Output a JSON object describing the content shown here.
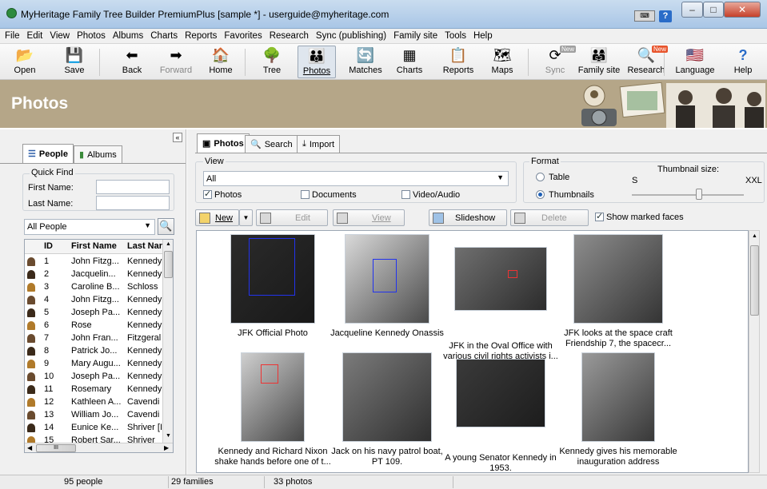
{
  "window": {
    "title": "MyHeritage Family Tree Builder PremiumPlus [sample *] - userguide@myheritage.com",
    "help_label": "?",
    "minimize": "–",
    "maximize": "□",
    "close": "✕"
  },
  "menu": [
    "File",
    "Edit",
    "View",
    "Photos",
    "Albums",
    "Charts",
    "Reports",
    "Favorites",
    "Research",
    "Sync (publishing)",
    "Family site",
    "Tools",
    "Help"
  ],
  "toolbar": [
    {
      "label": "Open",
      "icon": "folder-open-icon",
      "glyph": "📂"
    },
    {
      "label": "Save",
      "icon": "floppy-save-icon",
      "glyph": "💾"
    },
    {
      "label": "Back",
      "icon": "back-arrow-icon",
      "glyph": "⬅"
    },
    {
      "label": "Forward",
      "icon": "forward-arrow-icon",
      "glyph": "➡"
    },
    {
      "label": "Home",
      "icon": "home-icon",
      "glyph": "🏠"
    },
    {
      "label": "Tree",
      "icon": "tree-icon",
      "glyph": "🌳"
    },
    {
      "label": "Photos",
      "icon": "photos-icon",
      "glyph": "👪"
    },
    {
      "label": "Matches",
      "icon": "matches-icon",
      "glyph": "🔄"
    },
    {
      "label": "Charts",
      "icon": "charts-icon",
      "glyph": "▦"
    },
    {
      "label": "Reports",
      "icon": "reports-icon",
      "glyph": "📋"
    },
    {
      "label": "Maps",
      "icon": "maps-icon",
      "glyph": "🗺"
    },
    {
      "label": "Sync",
      "icon": "sync-icon",
      "glyph": "⟳"
    },
    {
      "label": "Family site",
      "icon": "family-site-icon",
      "glyph": "👨‍👩‍👧"
    },
    {
      "label": "Research",
      "icon": "research-icon",
      "glyph": "🔍"
    },
    {
      "label": "Language",
      "icon": "language-flag-icon",
      "glyph": "🇺🇸"
    },
    {
      "label": "Help",
      "icon": "help-icon",
      "glyph": "?"
    }
  ],
  "badges": {
    "sync_new": "New",
    "research_new": "New"
  },
  "banner": {
    "title": "Photos"
  },
  "left": {
    "tabs": [
      "People",
      "Albums"
    ],
    "quick_find": "Quick Find",
    "first_name_label": "First Name:",
    "last_name_label": "Last Name:",
    "filter_value": "All People",
    "columns": [
      "ID",
      "First Name",
      "Last Nar"
    ],
    "rows": [
      [
        "1",
        "John Fitzg...",
        "Kennedy"
      ],
      [
        "2",
        "Jacquelin...",
        "Kennedy"
      ],
      [
        "3",
        "Caroline B...",
        "Schloss"
      ],
      [
        "4",
        "John Fitzg...",
        "Kennedy"
      ],
      [
        "5",
        "Joseph Pa...",
        "Kennedy"
      ],
      [
        "6",
        "Rose",
        "Kennedy"
      ],
      [
        "7",
        "John Fran...",
        "Fitzgeral"
      ],
      [
        "8",
        "Patrick Jo...",
        "Kennedy"
      ],
      [
        "9",
        "Mary Augu...",
        "Kennedy"
      ],
      [
        "10",
        "Joseph Pa...",
        "Kennedy"
      ],
      [
        "11",
        "Rosemary",
        "Kennedy"
      ],
      [
        "12",
        "Kathleen A...",
        "Cavendi"
      ],
      [
        "13",
        "William Jo...",
        "Cavendi"
      ],
      [
        "14",
        "Eunice Ke...",
        "Shriver [I"
      ],
      [
        "15",
        "Robert Sar...",
        "Shriver"
      ]
    ],
    "hscroll_grip": "III"
  },
  "right": {
    "tabs": [
      "Photos",
      "Search",
      "Import"
    ],
    "view_label": "View",
    "view_value": "All",
    "filters": [
      {
        "label": "Photos",
        "checked": true
      },
      {
        "label": "Documents",
        "checked": false
      },
      {
        "label": "Video/Audio",
        "checked": false
      }
    ],
    "format_label": "Format",
    "format_options": [
      {
        "label": "Table",
        "selected": false
      },
      {
        "label": "Thumbnails",
        "selected": true
      }
    ],
    "thumb_size_label": "Thumbnail size:",
    "thumb_size_min": "S",
    "thumb_size_max": "XXL",
    "thumb_size_level": 0.6,
    "actions": {
      "new": "New",
      "edit": "Edit",
      "view": "View",
      "slideshow": "Slideshow",
      "delete": "Delete",
      "show_faces": "Show marked faces"
    },
    "photos": [
      {
        "cap1": "JFK Official Photo",
        "cap2": ""
      },
      {
        "cap1": "Jacqueline Kennedy Onassis",
        "cap2": ""
      },
      {
        "cap1": "JFK in the Oval Office with",
        "cap2": "various civil rights activists i..."
      },
      {
        "cap1": "JFK looks at the space craft",
        "cap2": "Friendship 7, the spacecr..."
      },
      {
        "cap1": "Kennedy and Richard Nixon",
        "cap2": "shake hands before one of t..."
      },
      {
        "cap1": "Jack on his navy patrol boat,",
        "cap2": "PT 109."
      },
      {
        "cap1": "A young Senator Kennedy in",
        "cap2": "1953."
      },
      {
        "cap1": "Kennedy gives his memorable",
        "cap2": "inauguration address"
      }
    ]
  },
  "status": {
    "people": "95 people",
    "families": "29 families",
    "photos": "33 photos"
  }
}
